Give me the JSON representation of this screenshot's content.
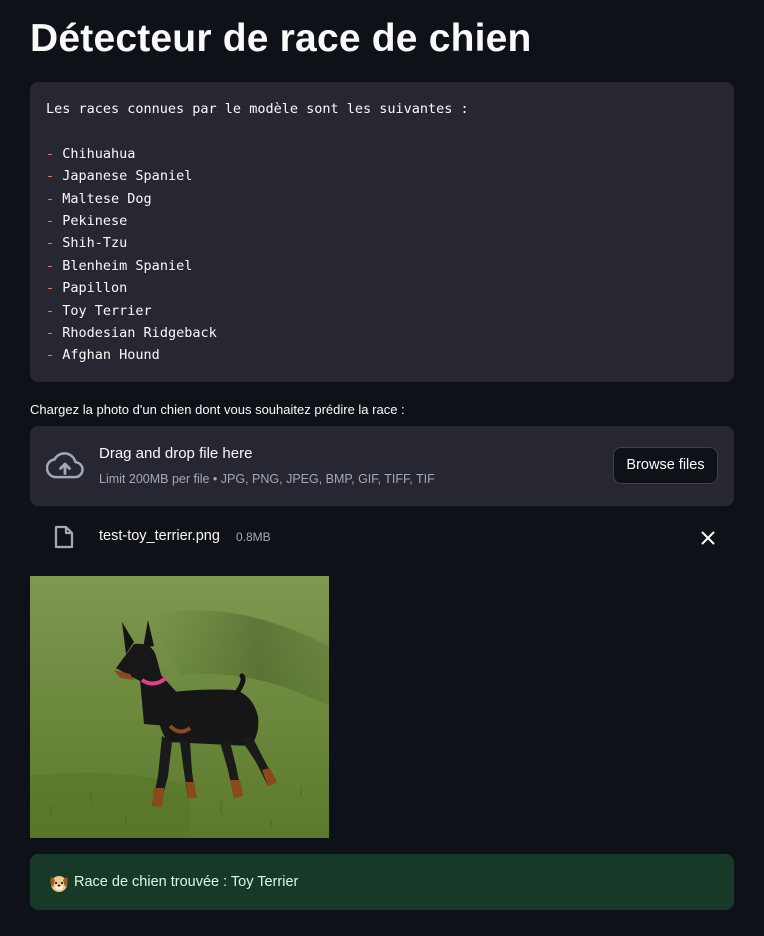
{
  "page": {
    "title": "Détecteur de race de chien"
  },
  "breeds_block": {
    "intro": "Les races connues par le modèle sont les suivantes :",
    "bullet": "-",
    "items": [
      "Chihuahua",
      "Japanese Spaniel",
      "Maltese Dog",
      "Pekinese",
      "Shih-Tzu",
      "Blenheim Spaniel",
      "Papillon",
      "Toy Terrier",
      "Rhodesian Ridgeback",
      "Afghan Hound"
    ]
  },
  "uploader": {
    "label": "Chargez la photo d'un chien dont vous souhaitez prédire la race :",
    "drop_text": "Drag and drop file here",
    "limit_text": "Limit 200MB per file • JPG, PNG, JPEG, BMP, GIF, TIFF, TIF",
    "browse_label": "Browse files",
    "icon": "cloud-upload-icon"
  },
  "uploaded_file": {
    "name": "test-toy_terrier.png",
    "size": "0.8MB",
    "icon": "file-icon",
    "remove_icon": "close-icon"
  },
  "result": {
    "emoji_icon": "dog-face-icon",
    "text": "Race de chien trouvée : Toy Terrier"
  },
  "colors": {
    "background": "#0e1117",
    "panel": "#262730",
    "success_bg": "#173928",
    "code_dash": "#ff7b72",
    "muted_text": "#a3a8b8"
  }
}
